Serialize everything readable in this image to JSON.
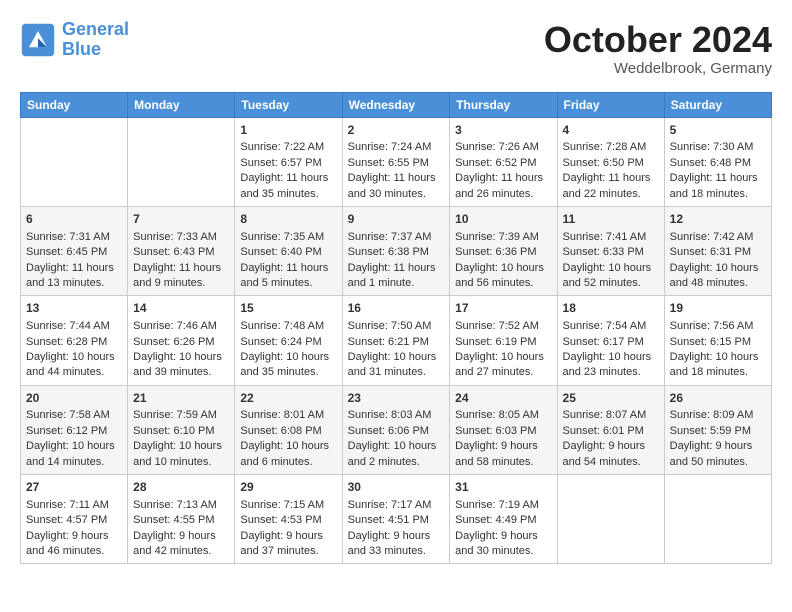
{
  "header": {
    "logo_line1": "General",
    "logo_line2": "Blue",
    "month_title": "October 2024",
    "location": "Weddelbrook, Germany"
  },
  "days_of_week": [
    "Sunday",
    "Monday",
    "Tuesday",
    "Wednesday",
    "Thursday",
    "Friday",
    "Saturday"
  ],
  "weeks": [
    [
      {
        "day": "",
        "content": ""
      },
      {
        "day": "",
        "content": ""
      },
      {
        "day": "1",
        "content": "Sunrise: 7:22 AM\nSunset: 6:57 PM\nDaylight: 11 hours and 35 minutes."
      },
      {
        "day": "2",
        "content": "Sunrise: 7:24 AM\nSunset: 6:55 PM\nDaylight: 11 hours and 30 minutes."
      },
      {
        "day": "3",
        "content": "Sunrise: 7:26 AM\nSunset: 6:52 PM\nDaylight: 11 hours and 26 minutes."
      },
      {
        "day": "4",
        "content": "Sunrise: 7:28 AM\nSunset: 6:50 PM\nDaylight: 11 hours and 22 minutes."
      },
      {
        "day": "5",
        "content": "Sunrise: 7:30 AM\nSunset: 6:48 PM\nDaylight: 11 hours and 18 minutes."
      }
    ],
    [
      {
        "day": "6",
        "content": "Sunrise: 7:31 AM\nSunset: 6:45 PM\nDaylight: 11 hours and 13 minutes."
      },
      {
        "day": "7",
        "content": "Sunrise: 7:33 AM\nSunset: 6:43 PM\nDaylight: 11 hours and 9 minutes."
      },
      {
        "day": "8",
        "content": "Sunrise: 7:35 AM\nSunset: 6:40 PM\nDaylight: 11 hours and 5 minutes."
      },
      {
        "day": "9",
        "content": "Sunrise: 7:37 AM\nSunset: 6:38 PM\nDaylight: 11 hours and 1 minute."
      },
      {
        "day": "10",
        "content": "Sunrise: 7:39 AM\nSunset: 6:36 PM\nDaylight: 10 hours and 56 minutes."
      },
      {
        "day": "11",
        "content": "Sunrise: 7:41 AM\nSunset: 6:33 PM\nDaylight: 10 hours and 52 minutes."
      },
      {
        "day": "12",
        "content": "Sunrise: 7:42 AM\nSunset: 6:31 PM\nDaylight: 10 hours and 48 minutes."
      }
    ],
    [
      {
        "day": "13",
        "content": "Sunrise: 7:44 AM\nSunset: 6:28 PM\nDaylight: 10 hours and 44 minutes."
      },
      {
        "day": "14",
        "content": "Sunrise: 7:46 AM\nSunset: 6:26 PM\nDaylight: 10 hours and 39 minutes."
      },
      {
        "day": "15",
        "content": "Sunrise: 7:48 AM\nSunset: 6:24 PM\nDaylight: 10 hours and 35 minutes."
      },
      {
        "day": "16",
        "content": "Sunrise: 7:50 AM\nSunset: 6:21 PM\nDaylight: 10 hours and 31 minutes."
      },
      {
        "day": "17",
        "content": "Sunrise: 7:52 AM\nSunset: 6:19 PM\nDaylight: 10 hours and 27 minutes."
      },
      {
        "day": "18",
        "content": "Sunrise: 7:54 AM\nSunset: 6:17 PM\nDaylight: 10 hours and 23 minutes."
      },
      {
        "day": "19",
        "content": "Sunrise: 7:56 AM\nSunset: 6:15 PM\nDaylight: 10 hours and 18 minutes."
      }
    ],
    [
      {
        "day": "20",
        "content": "Sunrise: 7:58 AM\nSunset: 6:12 PM\nDaylight: 10 hours and 14 minutes."
      },
      {
        "day": "21",
        "content": "Sunrise: 7:59 AM\nSunset: 6:10 PM\nDaylight: 10 hours and 10 minutes."
      },
      {
        "day": "22",
        "content": "Sunrise: 8:01 AM\nSunset: 6:08 PM\nDaylight: 10 hours and 6 minutes."
      },
      {
        "day": "23",
        "content": "Sunrise: 8:03 AM\nSunset: 6:06 PM\nDaylight: 10 hours and 2 minutes."
      },
      {
        "day": "24",
        "content": "Sunrise: 8:05 AM\nSunset: 6:03 PM\nDaylight: 9 hours and 58 minutes."
      },
      {
        "day": "25",
        "content": "Sunrise: 8:07 AM\nSunset: 6:01 PM\nDaylight: 9 hours and 54 minutes."
      },
      {
        "day": "26",
        "content": "Sunrise: 8:09 AM\nSunset: 5:59 PM\nDaylight: 9 hours and 50 minutes."
      }
    ],
    [
      {
        "day": "27",
        "content": "Sunrise: 7:11 AM\nSunset: 4:57 PM\nDaylight: 9 hours and 46 minutes."
      },
      {
        "day": "28",
        "content": "Sunrise: 7:13 AM\nSunset: 4:55 PM\nDaylight: 9 hours and 42 minutes."
      },
      {
        "day": "29",
        "content": "Sunrise: 7:15 AM\nSunset: 4:53 PM\nDaylight: 9 hours and 37 minutes."
      },
      {
        "day": "30",
        "content": "Sunrise: 7:17 AM\nSunset: 4:51 PM\nDaylight: 9 hours and 33 minutes."
      },
      {
        "day": "31",
        "content": "Sunrise: 7:19 AM\nSunset: 4:49 PM\nDaylight: 9 hours and 30 minutes."
      },
      {
        "day": "",
        "content": ""
      },
      {
        "day": "",
        "content": ""
      }
    ]
  ]
}
